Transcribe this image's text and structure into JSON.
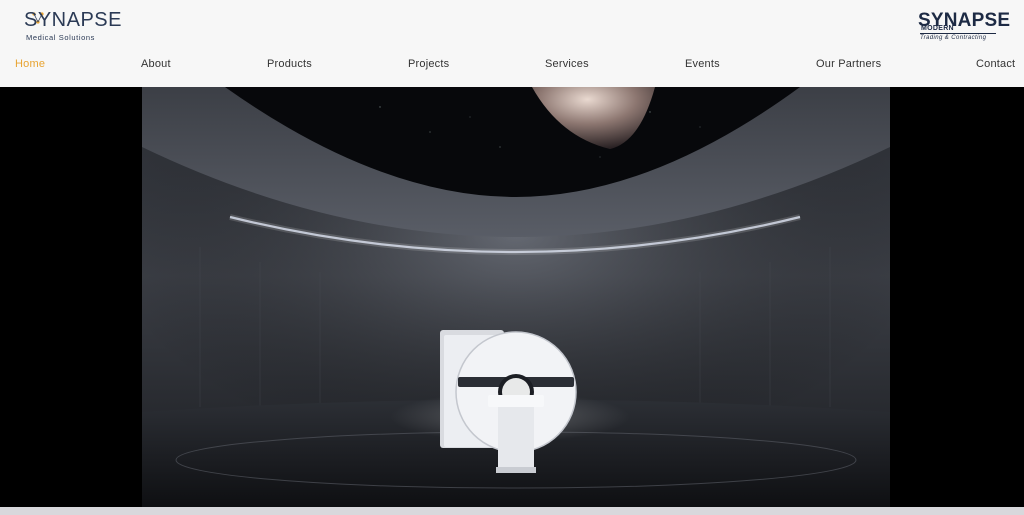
{
  "brand_left": {
    "name": "SYNAPSE",
    "tagline": "Medical Solutions"
  },
  "brand_right": {
    "name": "SYNAPSE",
    "line2": "MODERN",
    "line3": "Trading & Contracting"
  },
  "nav": {
    "items": [
      {
        "label": "Home",
        "active": true
      },
      {
        "label": "About",
        "active": false
      },
      {
        "label": "Products",
        "active": false
      },
      {
        "label": "Projects",
        "active": false
      },
      {
        "label": "Services",
        "active": false
      },
      {
        "label": "Events",
        "active": false
      },
      {
        "label": "Our Partners",
        "active": false
      },
      {
        "label": "Contact",
        "active": false
      }
    ]
  },
  "colors": {
    "accent": "#e8a432",
    "nav_text": "#333333",
    "brand": "#2b3a55",
    "hero_bg": "#000000"
  },
  "hero": {
    "image": "mri-scanner-in-dark-room"
  }
}
